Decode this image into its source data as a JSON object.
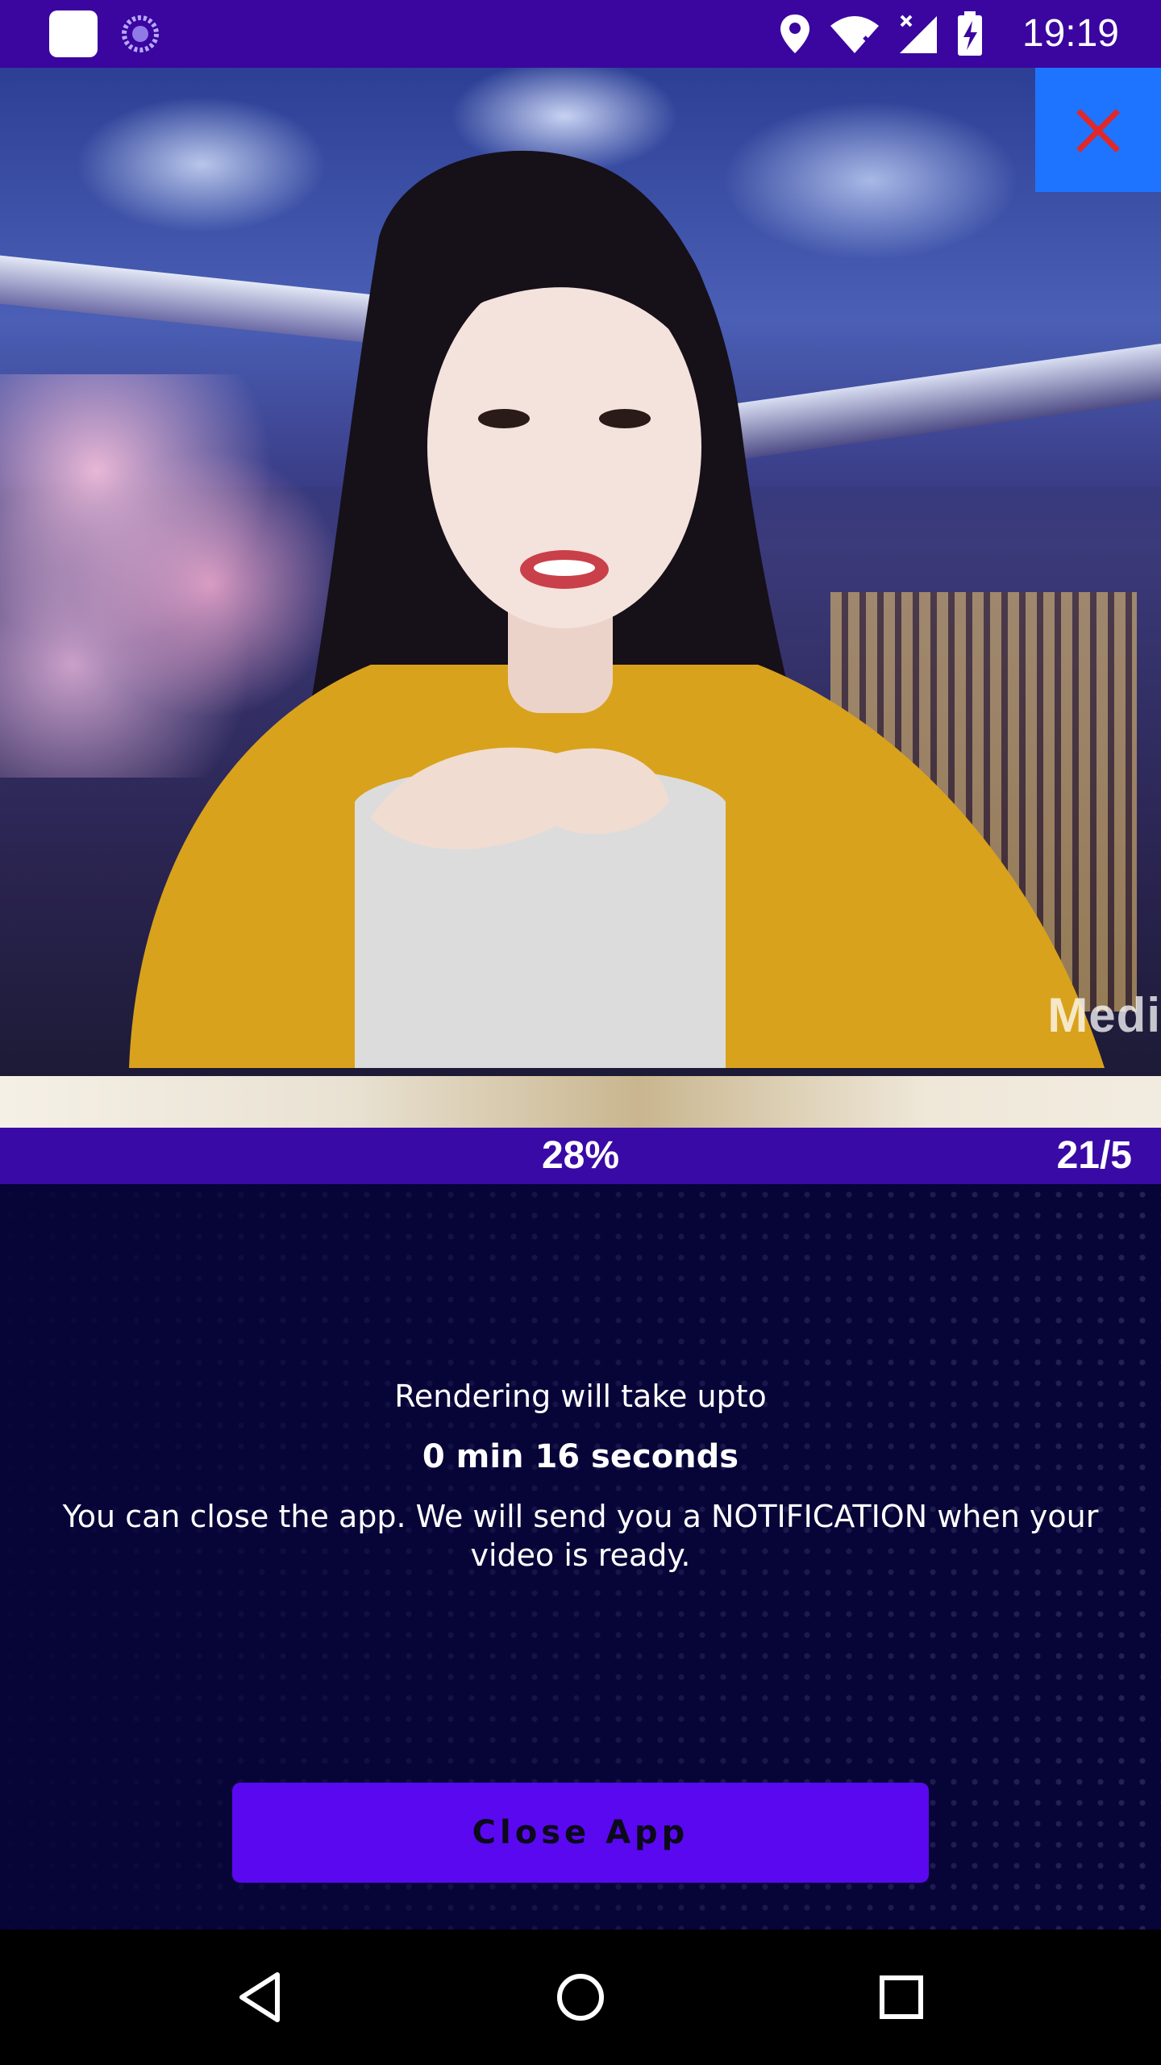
{
  "status_bar": {
    "time": "19:19",
    "icons": [
      "app-notification-icon",
      "sync-icon",
      "location-icon",
      "wifi-icon",
      "signal-icon",
      "battery-charging-icon"
    ]
  },
  "video": {
    "watermark": "Medi",
    "close_icon": "close-icon"
  },
  "progress": {
    "percent_label": "28%",
    "percent_value": 0.28,
    "count_label": "21/5"
  },
  "panel": {
    "line1": "Rendering will take upto",
    "line2": "0 min 16 seconds",
    "line3": "You can close the app. We will send you a NOTIFICATION when your video is ready.",
    "button_label": "Close App"
  },
  "nav_bar": {
    "icons": [
      "back-icon",
      "home-icon",
      "recents-icon"
    ]
  },
  "colors": {
    "status_bar": "#3a069f",
    "progress_bar": "#3a0aa6",
    "background": "#070438",
    "button": "#5a08f0",
    "close_tile": "#1e74ff",
    "close_x": "#e0282a"
  }
}
